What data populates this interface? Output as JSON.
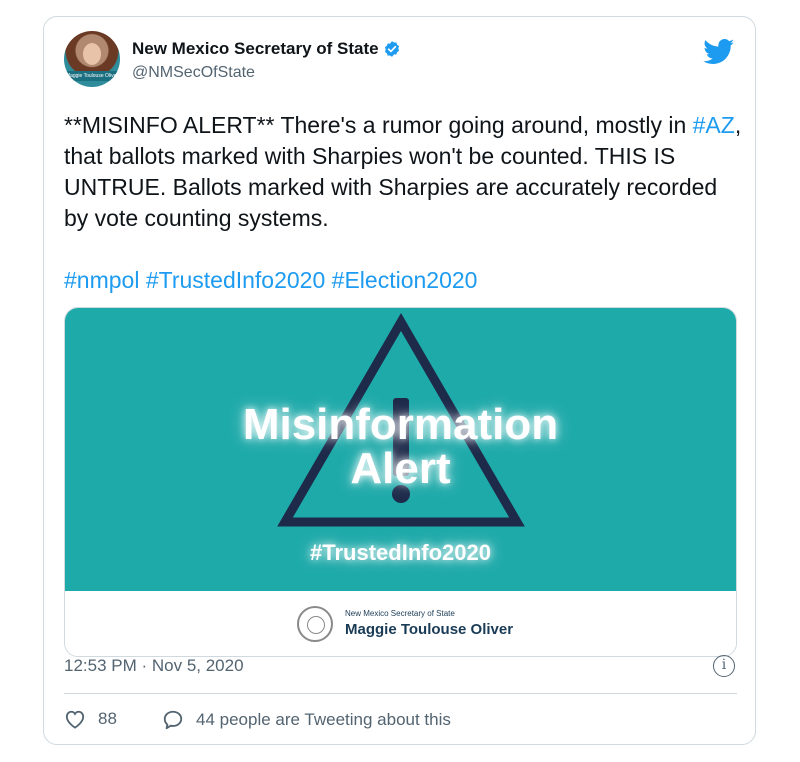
{
  "tweet": {
    "display_name": "New Mexico Secretary of State",
    "handle": "@NMSecOfState",
    "avatar_caption": "Maggie Toulouse Oliver",
    "text_main": "**MISINFO ALERT** There's a rumor going around, mostly in ",
    "hashtag_az": "#AZ",
    "text_rest": ", that ballots marked with Sharpies won't be counted. THIS IS UNTRUE. Ballots marked with Sharpies are accurately recorded by vote counting systems.",
    "hashtags": [
      "#nmpol",
      "#TrustedInfo2020",
      "#Election2020"
    ],
    "timestamp": "12:53 PM · Nov 5, 2020"
  },
  "media": {
    "title_line1": "Misinformation",
    "title_line2": "Alert",
    "hashtag": "#TrustedInfo2020",
    "office_label": "New Mexico Secretary of State",
    "official_name": "Maggie Toulouse Oliver",
    "background_color": "#1faaaa"
  },
  "actions": {
    "likes_count": "88",
    "conversation_label": "44 people are Tweeting about this"
  },
  "icons": {
    "verified": "verified-badge-icon",
    "brand": "twitter-bird-icon",
    "info": "info-icon",
    "like": "heart-icon",
    "reply": "speech-bubble-icon"
  },
  "colors": {
    "link": "#1d9bf0",
    "muted": "#536471",
    "text": "#0f1419"
  }
}
